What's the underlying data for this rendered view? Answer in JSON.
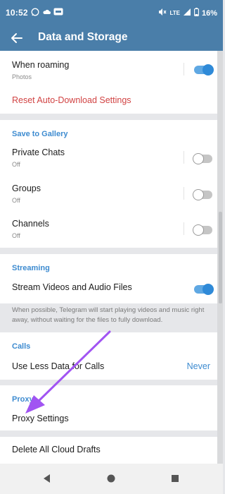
{
  "status": {
    "time": "10:52",
    "right_label": "LTE",
    "battery": "16%"
  },
  "appbar": {
    "title": "Data and Storage"
  },
  "roaming": {
    "title": "When roaming",
    "subtitle": "Photos",
    "toggle_on": true
  },
  "reset": {
    "label": "Reset Auto-Download Settings"
  },
  "gallery": {
    "header": "Save to Gallery",
    "items": [
      {
        "title": "Private Chats",
        "subtitle": "Off",
        "toggle_on": false
      },
      {
        "title": "Groups",
        "subtitle": "Off",
        "toggle_on": false
      },
      {
        "title": "Channels",
        "subtitle": "Off",
        "toggle_on": false
      }
    ]
  },
  "streaming": {
    "header": "Streaming",
    "item": {
      "title": "Stream Videos and Audio Files",
      "toggle_on": true
    },
    "note": "When possible, Telegram will start playing videos and music right away, without waiting for the files to fully download."
  },
  "calls": {
    "header": "Calls",
    "item": {
      "title": "Use Less Data for Calls",
      "value": "Never"
    }
  },
  "proxy": {
    "header": "Proxy",
    "item": {
      "title": "Proxy Settings"
    }
  },
  "drafts": {
    "label": "Delete All Cloud Drafts"
  },
  "colors": {
    "accent": "#4a7ea9",
    "link": "#3d8bd0",
    "danger": "#d14343",
    "annotation_arrow": "#a154f2"
  }
}
